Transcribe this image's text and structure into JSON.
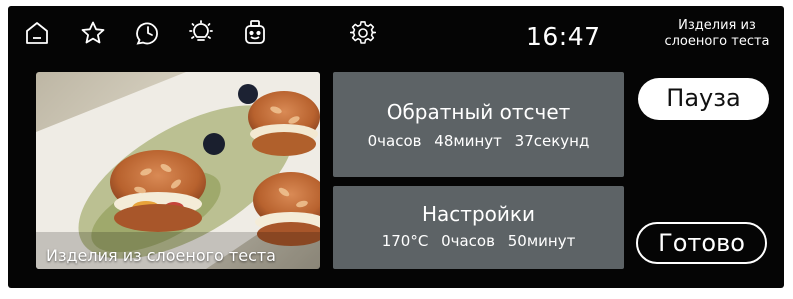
{
  "topbar": {
    "icons": [
      "home-icon",
      "star-icon",
      "clock-icon",
      "bulb-icon",
      "robot-icon",
      "gear-icon"
    ],
    "time": "16:47",
    "product_title": "Изделия из слоеного теста"
  },
  "photo": {
    "caption": "Изделия из слоеного теста"
  },
  "countdown": {
    "title": "Обратный отсчет",
    "hours": "0часов",
    "minutes": "48минут",
    "seconds": "37секунд"
  },
  "settings": {
    "title": "Настройки",
    "temperature": "170°C",
    "hours": "0часов",
    "minutes": "50минут"
  },
  "buttons": {
    "pause": "Пауза",
    "done": "Готово"
  },
  "colors": {
    "background": "#050505",
    "panel": "#5d6366",
    "text": "#ffffff"
  }
}
